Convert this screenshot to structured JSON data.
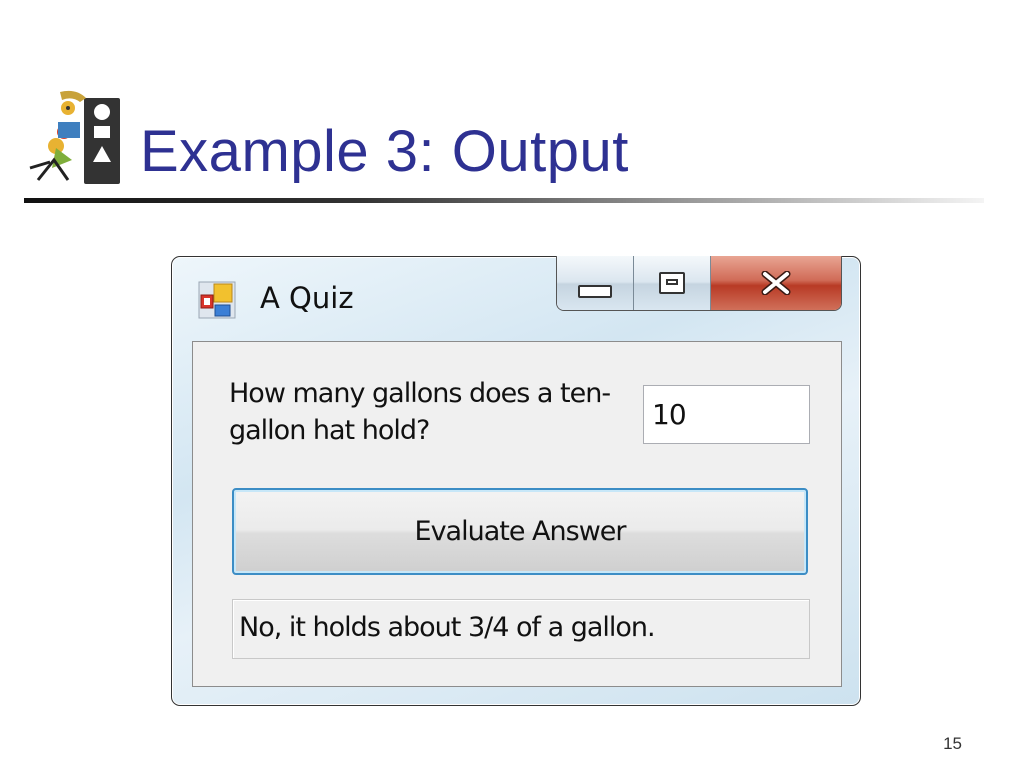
{
  "slide": {
    "title": "Example 3: Output",
    "page_number": "15",
    "title_color": "#2e3192"
  },
  "window": {
    "title": "A Quiz",
    "icon": "app-form-icon",
    "caption_buttons": [
      "minimize-icon",
      "maximize-icon",
      "close-icon"
    ]
  },
  "form": {
    "question": "How many gallons does a ten-gallon hat hold?",
    "answer_value": "10",
    "evaluate_label": "Evaluate Answer",
    "result": "No, it holds about 3/4 of a gallon."
  }
}
